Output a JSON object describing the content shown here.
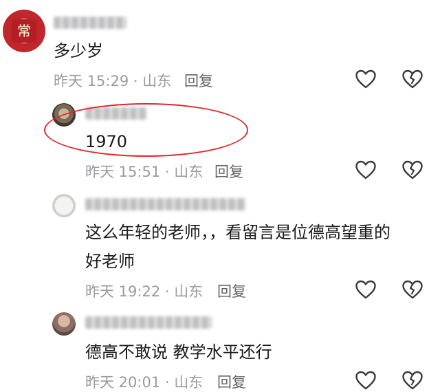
{
  "comments": [
    {
      "text": "多少岁",
      "time": "昨天 15:29 · 山东",
      "reply_label": "回复",
      "avatar_text": "常"
    },
    {
      "text": "1970",
      "time": "昨天 15:51 · 山东",
      "reply_label": "回复"
    },
    {
      "text_line1": "这么年轻的老师，，看留言是位德高望重的",
      "text_line2": "好老师",
      "time": "昨天 19:22 · 山东",
      "reply_label": "回复"
    },
    {
      "text": "德高不敢说 教学水平还行",
      "time": "昨天 20:01 · 山东",
      "reply_label": "回复"
    }
  ],
  "colors": {
    "highlight": "#e0282b",
    "meta": "#9a9a9f"
  },
  "icons": [
    "heart-icon",
    "broken-heart-icon"
  ]
}
